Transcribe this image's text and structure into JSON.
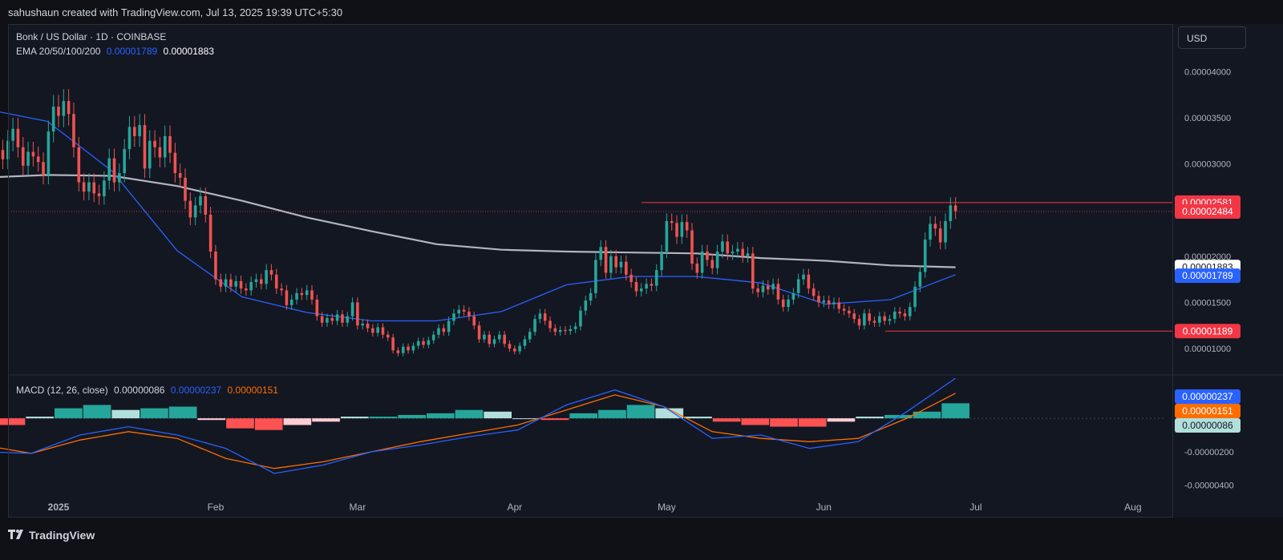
{
  "header": {
    "attribution": "sahushaun created with TradingView.com, Jul 13, 2025 19:39 UTC+5:30"
  },
  "legend": {
    "symbol": "Bonk / US Dollar · 1D · COINBASE",
    "ema_label": "EMA 20/50/100/200",
    "ema_value_1": "0.00001789",
    "ema_value_2": "0.00001883",
    "macd_label": "MACD (12, 26, close)",
    "macd_hist": "0.00000086",
    "macd_line": "0.00000237",
    "macd_signal": "0.00000151"
  },
  "currency_button": "USD",
  "footer": {
    "brand": "TradingView"
  },
  "colors": {
    "up": "#26a69a",
    "down": "#ef5350",
    "ema_fast": "#2962ff",
    "ema_slow": "#b2b5be",
    "signal": "#ff6d00",
    "level": "#f23645"
  },
  "chart_data": [
    {
      "type": "candlestick",
      "title": "Bonk / US Dollar · 1D · COINBASE",
      "x_ticks": [
        "2025",
        "Feb",
        "Mar",
        "Apr",
        "May",
        "Jun",
        "Jul",
        "Aug"
      ],
      "y_ticks": [
        "0.00004000",
        "0.00003500",
        "0.00003000",
        "0.00002000",
        "0.00001500",
        "0.00001000"
      ],
      "ylim": [
        7.4e-06,
        4.15e-05
      ],
      "dates_start": "2024-12-17",
      "closes": [
        3.2e-05,
        3.33e-05,
        3.45e-05,
        3.15e-05,
        3.05e-05,
        3.25e-05,
        3.38e-05,
        3.18e-05,
        2.98e-05,
        3.13e-05,
        3.08e-05,
        3.02e-05,
        2.88e-05,
        3.35e-05,
        3.62e-05,
        3.52e-05,
        3.68e-05,
        3.54e-05,
        3.18e-05,
        2.8e-05,
        2.7e-05,
        2.8e-05,
        2.68e-05,
        2.65e-05,
        2.82e-05,
        3.06e-05,
        2.8e-05,
        2.9e-05,
        3.16e-05,
        3.4e-05,
        3.3e-05,
        3.42e-05,
        2.95e-05,
        3.25e-05,
        3.18e-05,
        3.07e-05,
        3.3e-05,
        3.12e-05,
        2.9e-05,
        2.85e-05,
        2.6e-05,
        2.42e-05,
        2.55e-05,
        2.65e-05,
        2.45e-05,
        2.05e-05,
        1.75e-05,
        1.67e-05,
        1.75e-05,
        1.67e-05,
        1.73e-05,
        1.65e-05,
        1.63e-05,
        1.72e-05,
        1.75e-05,
        1.7e-05,
        1.85e-05,
        1.8e-05,
        1.65e-05,
        1.63e-05,
        1.47e-05,
        1.53e-05,
        1.6e-05,
        1.58e-05,
        1.63e-05,
        1.53e-05,
        1.35e-05,
        1.28e-05,
        1.33e-05,
        1.3e-05,
        1.37e-05,
        1.28e-05,
        1.35e-05,
        1.5e-05,
        1.25e-05,
        1.27e-05,
        1.22e-05,
        1.17e-05,
        1.23e-05,
        1.15e-05,
        1.12e-05,
        9.8e-06,
        9.5e-06,
        1.02e-05,
        9.8e-06,
        1.03e-05,
        1.08e-05,
        1.04e-05,
        1.09e-05,
        1.15e-05,
        1.22e-05,
        1.18e-05,
        1.3e-05,
        1.38e-05,
        1.42e-05,
        1.4e-05,
        1.35e-05,
        1.25e-05,
        1.1e-05,
        1.15e-05,
        1.05e-05,
        1.1e-05,
        1.15e-05,
        1.05e-05,
        1e-05,
        9.7e-06,
        1.03e-05,
        1.1e-05,
        1.18e-05,
        1.32e-05,
        1.38e-05,
        1.3e-05,
        1.22e-05,
        1.18e-05,
        1.2e-05,
        1.19e-05,
        1.21e-05,
        1.24e-05,
        1.41e-05,
        1.52e-05,
        1.6e-05,
        1.96e-05,
        2.1e-05,
        1.82e-05,
        2e-05,
        1.88e-05,
        1.94e-05,
        1.8e-05,
        1.72e-05,
        1.62e-05,
        1.65e-05,
        1.7e-05,
        1.68e-05,
        1.85e-05,
        2.05e-05,
        2.38e-05,
        2.36e-05,
        2.21e-05,
        2.37e-05,
        2.28e-05,
        1.92e-05,
        1.82e-05,
        2.05e-05,
        1.96e-05,
        1.87e-05,
        2.05e-05,
        2.16e-05,
        2.03e-05,
        2.05e-05,
        2.08e-05,
        2e-05,
        2.03e-05,
        1.65e-05,
        1.61e-05,
        1.68e-05,
        1.64e-05,
        1.7e-05,
        1.53e-05,
        1.45e-05,
        1.53e-05,
        1.6e-05,
        1.75e-05,
        1.8e-05,
        1.65e-05,
        1.57e-05,
        1.5e-05,
        1.52e-05,
        1.48e-05,
        1.5e-05,
        1.43e-05,
        1.41e-05,
        1.38e-05,
        1.32e-05,
        1.25e-05,
        1.38e-05,
        1.3e-05,
        1.28e-05,
        1.35e-05,
        1.3e-05,
        1.32e-05,
        1.4e-05,
        1.38e-05,
        1.35e-05,
        1.45e-05,
        1.67e-05,
        1.83e-05,
        2.18e-05,
        2.35e-05,
        2.3e-05,
        2.15e-05,
        2.38e-05,
        2.55e-05,
        2.49e-05
      ],
      "ema_fast": [
        3.6e-05,
        3.46e-05,
        2.92e-05,
        2.06e-05,
        1.56e-05,
        1.39e-05,
        1.3e-05,
        1.3e-05,
        1.4e-05,
        1.69e-05,
        1.78e-05,
        1.78e-05,
        1.71e-05,
        1.48e-05,
        1.53e-05,
        1.8e-05
      ],
      "ema_slow": [
        2.85e-05,
        2.88e-05,
        2.87e-05,
        2.76e-05,
        2.6e-05,
        2.42e-05,
        2.27e-05,
        2.13e-05,
        2.07e-05,
        2.05e-05,
        2.04e-05,
        2.03e-05,
        1.98e-05,
        1.95e-05,
        1.9e-05,
        1.88e-05
      ],
      "levels": [
        "0.00002581",
        "0.00002484",
        "0.00001883",
        "0.00001789",
        "0.00001189"
      ]
    },
    {
      "type": "macd",
      "title": "MACD (12, 26, close)",
      "y_ticks": [
        "0.00000000",
        "-0.00000200",
        "-0.00000400"
      ],
      "ylim": [
        -4.5e-06,
        2.5e-06
      ],
      "macd_line": [
        -2e-06,
        -2.1e-06,
        -1e-06,
        -5e-07,
        -1e-06,
        -1.8e-06,
        -3.3e-06,
        -2.8e-06,
        -2e-06,
        -1.6e-06,
        -1.1e-06,
        -7e-07,
        8e-07,
        1.7e-06,
        7e-07,
        -1.2e-06,
        -1e-06,
        -1.8e-06,
        -1.4e-06,
        4e-07,
        2.4e-06
      ],
      "signal_line": [
        -1.6e-06,
        -2.1e-06,
        -1.3e-06,
        -8e-07,
        -1.2e-06,
        -2.4e-06,
        -3e-06,
        -2.6e-06,
        -2e-06,
        -1.4e-06,
        -9e-07,
        -4e-07,
        5e-07,
        1.4e-06,
        7e-07,
        -8e-07,
        -1.2e-06,
        -1.4e-06,
        -1.2e-06,
        0.0,
        1.5e-06
      ],
      "histogram": [
        -4e-07,
        1e-07,
        6e-07,
        8e-07,
        5e-07,
        6e-07,
        7e-07,
        -1e-07,
        -6e-07,
        -7e-07,
        -4e-07,
        -2e-07,
        1e-07,
        1e-07,
        2e-07,
        3e-07,
        5e-07,
        4e-07,
        0.0,
        -1e-07,
        3e-07,
        5e-07,
        8e-07,
        6e-07,
        1e-07,
        -2e-07,
        -4e-07,
        -5e-07,
        -5e-07,
        -2e-07,
        1e-07,
        2e-07,
        4e-07,
        9e-07
      ]
    }
  ]
}
